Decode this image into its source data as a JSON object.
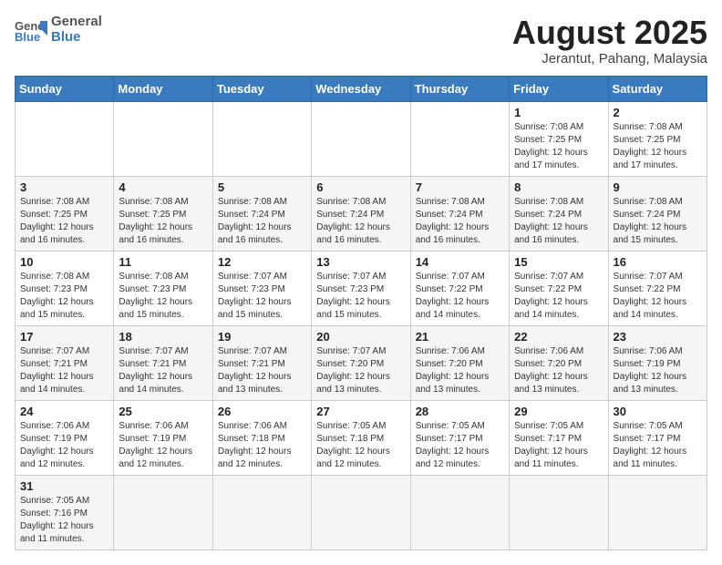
{
  "header": {
    "logo_general": "General",
    "logo_blue": "Blue",
    "month_title": "August 2025",
    "location": "Jerantut, Pahang, Malaysia"
  },
  "days_of_week": [
    "Sunday",
    "Monday",
    "Tuesday",
    "Wednesday",
    "Thursday",
    "Friday",
    "Saturday"
  ],
  "weeks": [
    [
      {
        "day": "",
        "info": ""
      },
      {
        "day": "",
        "info": ""
      },
      {
        "day": "",
        "info": ""
      },
      {
        "day": "",
        "info": ""
      },
      {
        "day": "",
        "info": ""
      },
      {
        "day": "1",
        "info": "Sunrise: 7:08 AM\nSunset: 7:25 PM\nDaylight: 12 hours and 17 minutes."
      },
      {
        "day": "2",
        "info": "Sunrise: 7:08 AM\nSunset: 7:25 PM\nDaylight: 12 hours and 17 minutes."
      }
    ],
    [
      {
        "day": "3",
        "info": "Sunrise: 7:08 AM\nSunset: 7:25 PM\nDaylight: 12 hours and 16 minutes."
      },
      {
        "day": "4",
        "info": "Sunrise: 7:08 AM\nSunset: 7:25 PM\nDaylight: 12 hours and 16 minutes."
      },
      {
        "day": "5",
        "info": "Sunrise: 7:08 AM\nSunset: 7:24 PM\nDaylight: 12 hours and 16 minutes."
      },
      {
        "day": "6",
        "info": "Sunrise: 7:08 AM\nSunset: 7:24 PM\nDaylight: 12 hours and 16 minutes."
      },
      {
        "day": "7",
        "info": "Sunrise: 7:08 AM\nSunset: 7:24 PM\nDaylight: 12 hours and 16 minutes."
      },
      {
        "day": "8",
        "info": "Sunrise: 7:08 AM\nSunset: 7:24 PM\nDaylight: 12 hours and 16 minutes."
      },
      {
        "day": "9",
        "info": "Sunrise: 7:08 AM\nSunset: 7:24 PM\nDaylight: 12 hours and 15 minutes."
      }
    ],
    [
      {
        "day": "10",
        "info": "Sunrise: 7:08 AM\nSunset: 7:23 PM\nDaylight: 12 hours and 15 minutes."
      },
      {
        "day": "11",
        "info": "Sunrise: 7:08 AM\nSunset: 7:23 PM\nDaylight: 12 hours and 15 minutes."
      },
      {
        "day": "12",
        "info": "Sunrise: 7:07 AM\nSunset: 7:23 PM\nDaylight: 12 hours and 15 minutes."
      },
      {
        "day": "13",
        "info": "Sunrise: 7:07 AM\nSunset: 7:23 PM\nDaylight: 12 hours and 15 minutes."
      },
      {
        "day": "14",
        "info": "Sunrise: 7:07 AM\nSunset: 7:22 PM\nDaylight: 12 hours and 14 minutes."
      },
      {
        "day": "15",
        "info": "Sunrise: 7:07 AM\nSunset: 7:22 PM\nDaylight: 12 hours and 14 minutes."
      },
      {
        "day": "16",
        "info": "Sunrise: 7:07 AM\nSunset: 7:22 PM\nDaylight: 12 hours and 14 minutes."
      }
    ],
    [
      {
        "day": "17",
        "info": "Sunrise: 7:07 AM\nSunset: 7:21 PM\nDaylight: 12 hours and 14 minutes."
      },
      {
        "day": "18",
        "info": "Sunrise: 7:07 AM\nSunset: 7:21 PM\nDaylight: 12 hours and 14 minutes."
      },
      {
        "day": "19",
        "info": "Sunrise: 7:07 AM\nSunset: 7:21 PM\nDaylight: 12 hours and 13 minutes."
      },
      {
        "day": "20",
        "info": "Sunrise: 7:07 AM\nSunset: 7:20 PM\nDaylight: 12 hours and 13 minutes."
      },
      {
        "day": "21",
        "info": "Sunrise: 7:06 AM\nSunset: 7:20 PM\nDaylight: 12 hours and 13 minutes."
      },
      {
        "day": "22",
        "info": "Sunrise: 7:06 AM\nSunset: 7:20 PM\nDaylight: 12 hours and 13 minutes."
      },
      {
        "day": "23",
        "info": "Sunrise: 7:06 AM\nSunset: 7:19 PM\nDaylight: 12 hours and 13 minutes."
      }
    ],
    [
      {
        "day": "24",
        "info": "Sunrise: 7:06 AM\nSunset: 7:19 PM\nDaylight: 12 hours and 12 minutes."
      },
      {
        "day": "25",
        "info": "Sunrise: 7:06 AM\nSunset: 7:19 PM\nDaylight: 12 hours and 12 minutes."
      },
      {
        "day": "26",
        "info": "Sunrise: 7:06 AM\nSunset: 7:18 PM\nDaylight: 12 hours and 12 minutes."
      },
      {
        "day": "27",
        "info": "Sunrise: 7:05 AM\nSunset: 7:18 PM\nDaylight: 12 hours and 12 minutes."
      },
      {
        "day": "28",
        "info": "Sunrise: 7:05 AM\nSunset: 7:17 PM\nDaylight: 12 hours and 12 minutes."
      },
      {
        "day": "29",
        "info": "Sunrise: 7:05 AM\nSunset: 7:17 PM\nDaylight: 12 hours and 11 minutes."
      },
      {
        "day": "30",
        "info": "Sunrise: 7:05 AM\nSunset: 7:17 PM\nDaylight: 12 hours and 11 minutes."
      }
    ],
    [
      {
        "day": "31",
        "info": "Sunrise: 7:05 AM\nSunset: 7:16 PM\nDaylight: 12 hours and 11 minutes."
      },
      {
        "day": "",
        "info": ""
      },
      {
        "day": "",
        "info": ""
      },
      {
        "day": "",
        "info": ""
      },
      {
        "day": "",
        "info": ""
      },
      {
        "day": "",
        "info": ""
      },
      {
        "day": "",
        "info": ""
      }
    ]
  ]
}
